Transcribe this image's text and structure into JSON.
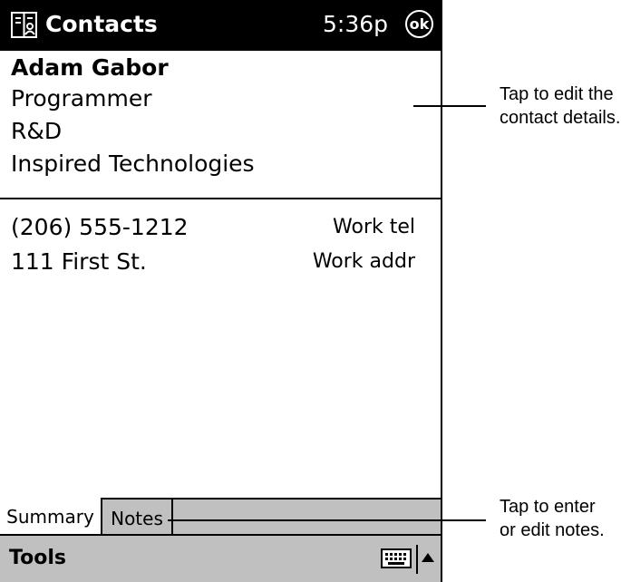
{
  "titlebar": {
    "app_title": "Contacts",
    "clock": "5:36p",
    "ok_label": "ok"
  },
  "contact": {
    "name": "Adam Gabor",
    "title": "Programmer",
    "department": "R&D",
    "company": "Inspired Technologies"
  },
  "details": [
    {
      "value": "(206) 555-1212",
      "label": "Work tel"
    },
    {
      "value": "111 First St.",
      "label": "Work addr"
    }
  ],
  "tabs": [
    {
      "label": "Summary",
      "selected": true
    },
    {
      "label": "Notes",
      "selected": false
    }
  ],
  "menubar": {
    "tools_label": "Tools",
    "icons": [
      "keyboard-icon",
      "up-arrow-icon"
    ]
  },
  "callouts": {
    "edit_details": {
      "line1": "Tap to edit the",
      "line2": "contact details."
    },
    "edit_notes": {
      "line1": "Tap to enter",
      "line2": "or edit notes."
    }
  }
}
